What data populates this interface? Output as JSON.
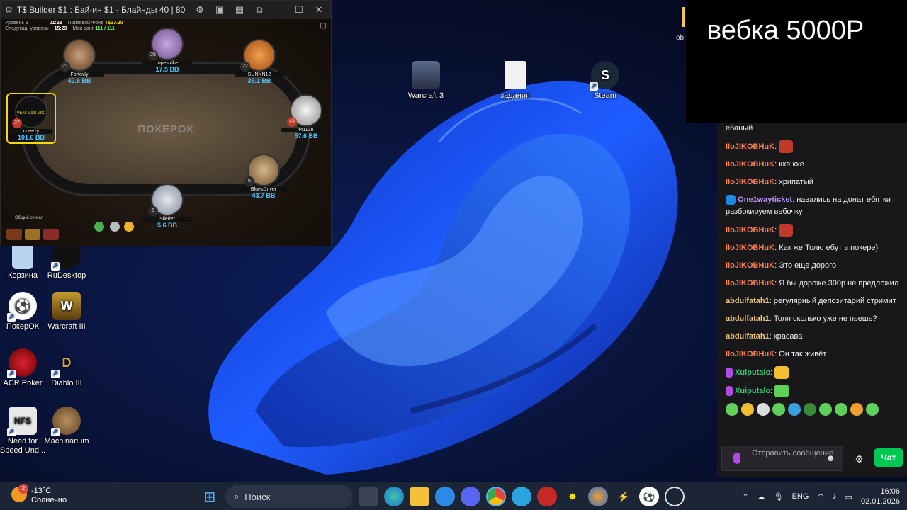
{
  "colors": {
    "accent_green": "#00c853",
    "hero_highlight": "#f5d90a",
    "bb_blue": "#4fc3ff"
  },
  "poker": {
    "title": "T$ Builder $1 : Бай-ин $1 - Блайнды 40 | 80 - С...",
    "info": {
      "level_label": "Уровень 3",
      "time": "01:23",
      "prize_label": "Призовой Фонд",
      "prize": "T$27.30",
      "next_label": "Следующ. уровень",
      "next_time": "15:29",
      "rank_label": "Мой ранг",
      "rank": "111 / 111"
    },
    "brand": "ПОКЕРОК",
    "footer_label": "Общий сигнал",
    "seats": [
      {
        "name": "Fortovly",
        "level": "21",
        "bb": "42.8 BB"
      },
      {
        "name": "topestrike",
        "level": "29",
        "bb": "17.5 BB"
      },
      {
        "name": "SUNNN12",
        "level": "22",
        "bb": "38.1 BB"
      },
      {
        "name": "coeezy",
        "level": "37",
        "bb": "101.6 BB"
      },
      {
        "name": "f4113n",
        "level": "45",
        "bb": "57.6 BB"
      },
      {
        "name": "BluesDriver",
        "level": "6",
        "bb": "43.7 BB"
      },
      {
        "name": "Slieder",
        "level": "5",
        "bb": "5.6 BB"
      }
    ],
    "avatar_caption": "VENI VIDI VICI"
  },
  "desktop": {
    "icons": [
      {
        "label": "Warcraft 3",
        "icon": "warcraft3-icon"
      },
      {
        "label": "задания",
        "icon": "document-icon"
      },
      {
        "label": "Steam",
        "icon": "steam-icon"
      },
      {
        "label": "Корзина",
        "icon": "recycle-bin-icon"
      },
      {
        "label": "RuDesktop",
        "icon": "rudesktop-icon"
      },
      {
        "label": "ПокерОК",
        "icon": "pokerok-icon"
      },
      {
        "label": "Warcraft III",
        "icon": "warcraft3-icon"
      },
      {
        "label": "ACR Poker",
        "icon": "acr-poker-icon"
      },
      {
        "label": "Diablo III",
        "icon": "diablo-icon"
      },
      {
        "label": "Need for Speed Und...",
        "icon": "nfs-icon"
      },
      {
        "label": "Machinarium",
        "icon": "machinarium-icon"
      }
    ]
  },
  "overlay": {
    "title": "вебка 5000Р",
    "ob": "ob"
  },
  "chat": {
    "messages": [
      {
        "user": "",
        "text": "ебаный"
      },
      {
        "user": "IIoJIKOBHuK",
        "text": ""
      },
      {
        "user": "IIoJIKOBHuK",
        "text": "кхе кхе"
      },
      {
        "user": "IIoJIKOBHuK",
        "text": "хрипатый"
      },
      {
        "user": "One1wayticket",
        "text": "навались на донат ебятки разбокируем вебочку"
      },
      {
        "user": "IIoJIKOBHuK",
        "text": ""
      },
      {
        "user": "IIoJIKOBHuK",
        "text": "Как же Толю ебут в покере)"
      },
      {
        "user": "IIoJIKOBHuK",
        "text": "Это еще дорого"
      },
      {
        "user": "IIoJIKOBHuK",
        "text": "Я бы дороже 300р не предложил"
      },
      {
        "user": "abdulfatah1",
        "text": "регулярный депозитарий стримит"
      },
      {
        "user": "abdulfatah1",
        "text": "Толя сколько уже не пьешь?"
      },
      {
        "user": "abdulfatah1",
        "text": "красава"
      },
      {
        "user": "IIoJIKOBHuK",
        "text": "Он так живёт"
      },
      {
        "user": "Xuiputalo",
        "text": ""
      },
      {
        "user": "Xuiputalo",
        "text": ""
      }
    ],
    "input_placeholder": "Отправить сообщение",
    "send_label": "Чат"
  },
  "taskbar": {
    "weather_temp": "-13°C",
    "weather_desc": "Солнечно",
    "weather_badge": "2",
    "search_label": "Поиск",
    "lang": "ENG",
    "time": "16:06",
    "date": "02.01.2026"
  }
}
